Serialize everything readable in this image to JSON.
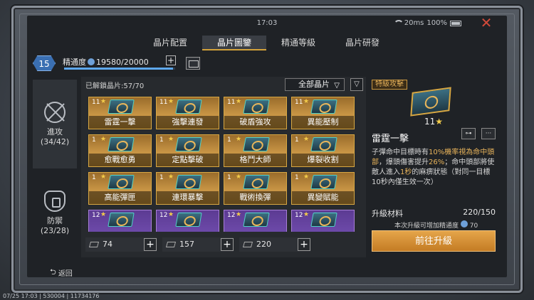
{
  "status": {
    "time": "17:03",
    "ping": "20ms",
    "battery": "100%"
  },
  "tabs": [
    "晶片配置",
    "晶片圖鑒",
    "精通等級",
    "晶片研發"
  ],
  "active_tab": 1,
  "mastery": {
    "rank": "15",
    "label": "精通度",
    "value": "19580/20000",
    "fraction": 0.979
  },
  "sidebar": [
    {
      "label": "進攻",
      "count": "(34/42)"
    },
    {
      "label": "防禦",
      "count": "(23/28)"
    }
  ],
  "grid": {
    "unlocked": "已解鎖晶片:57/70",
    "filter": "全部晶片",
    "chips": [
      {
        "level": "11",
        "name": "雷霆一擊",
        "color": "gold"
      },
      {
        "level": "11",
        "name": "強擊連發",
        "color": "gold"
      },
      {
        "level": "11",
        "name": "破盾強攻",
        "color": "gold"
      },
      {
        "level": "11",
        "name": "異能壓制",
        "color": "gold"
      },
      {
        "level": "1",
        "name": "愈戰愈勇",
        "color": "gold"
      },
      {
        "level": "1",
        "name": "定點擊破",
        "color": "gold"
      },
      {
        "level": "1",
        "name": "格鬥大師",
        "color": "gold"
      },
      {
        "level": "1",
        "name": "爆裂收割",
        "color": "gold"
      },
      {
        "level": "1",
        "name": "高能彈匣",
        "color": "gold"
      },
      {
        "level": "1",
        "name": "連環暴擊",
        "color": "gold"
      },
      {
        "level": "1",
        "name": "戰術換彈",
        "color": "gold"
      },
      {
        "level": "1",
        "name": "異變賦能",
        "color": "gold"
      },
      {
        "level": "12",
        "name": "",
        "color": "purple"
      },
      {
        "level": "12",
        "name": "",
        "color": "purple"
      },
      {
        "level": "12",
        "name": "",
        "color": "purple"
      },
      {
        "level": "12",
        "name": "",
        "color": "purple"
      }
    ]
  },
  "resources": [
    {
      "value": "74"
    },
    {
      "value": "157"
    },
    {
      "value": "220"
    }
  ],
  "back_label": "返回",
  "detail": {
    "type": "特級攻擊",
    "level": "11",
    "name": "雷霆一擊",
    "desc_1": "子彈命中目標時有",
    "desc_hl1": "10%機率視為命中頭部",
    "desc_2": "，爆頭傷害提升",
    "desc_hl2": "26%",
    "desc_3": "；命中頭部將使敵人進入",
    "desc_hl3": "1秒",
    "desc_4": "的麻痹狀態（對同一目標10秒內僅生效一次）",
    "upgrade_label": "升級材料",
    "upgrade_cost": "220/150",
    "upgrade_note": "本次升級可增加精通度",
    "upgrade_note_val": "70",
    "upgrade_btn": "前往升級"
  },
  "footer": "07/25 17:03 | 530004 | 11734176"
}
